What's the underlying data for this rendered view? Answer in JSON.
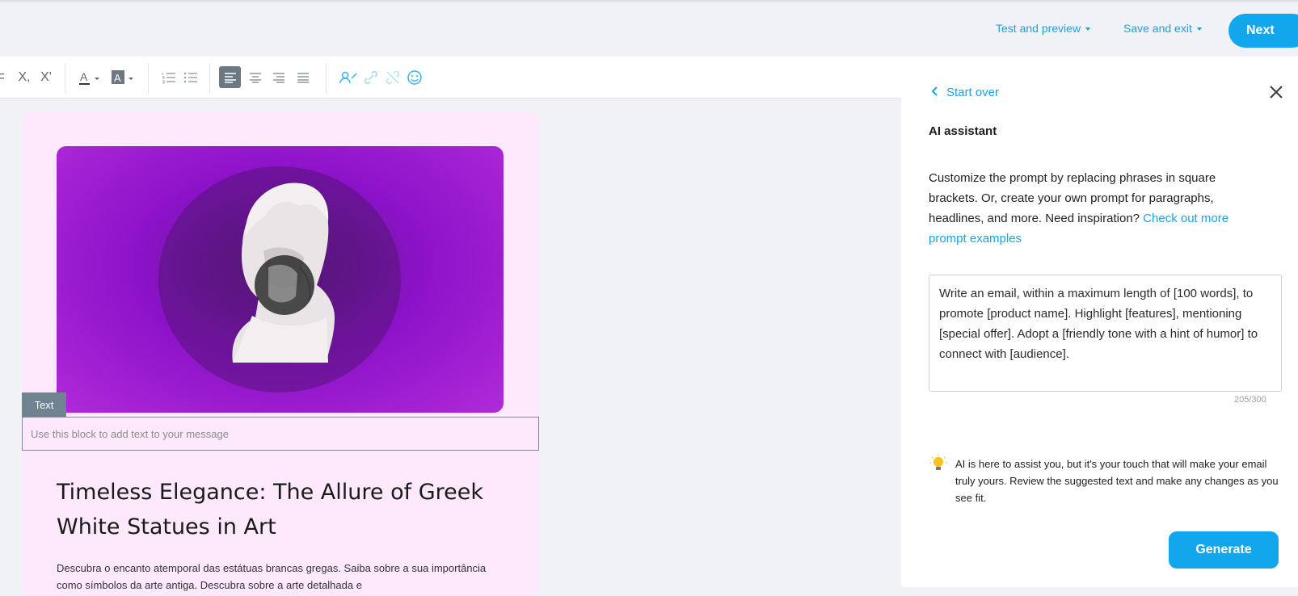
{
  "topbar": {
    "test_preview": "Test and preview",
    "save_exit": "Save and exit",
    "next": "Next"
  },
  "toolbar": {
    "subscript_label": "X,",
    "superscript_label": "X'"
  },
  "editor": {
    "text_tag": "Text",
    "text_placeholder": "Use this block to add text to your message",
    "headline": "Timeless Elegance: The Allure of Greek White Statues in Art",
    "body": "Descubra o encanto atemporal das estátuas brancas gregas. Saiba sobre a sua importância como símbolos da arte antiga. Descubra sobre a arte detalhada e"
  },
  "panel": {
    "start_over": "Start over",
    "title": "AI assistant",
    "description": "Customize the prompt by replacing phrases in square brackets. Or, create your own prompt for paragraphs, headlines, and more. Need inspiration?",
    "description_link": "Check out more prompt examples",
    "prompt": "Write an email, within a maximum length of [100 words], to promote [product name]. Highlight [features], mentioning [special offer]. Adopt a [friendly tone with a hint of humor] to connect with [audience].",
    "counter": "205/300",
    "tip": "AI is here to assist you, but it's your touch that will make your email truly yours. Review the suggested text and make any changes as you see fit.",
    "generate": "Generate"
  },
  "colors": {
    "accent": "#12a7ec",
    "card_bg": "#fde9fb",
    "hero_purple": "#8c12c9"
  }
}
